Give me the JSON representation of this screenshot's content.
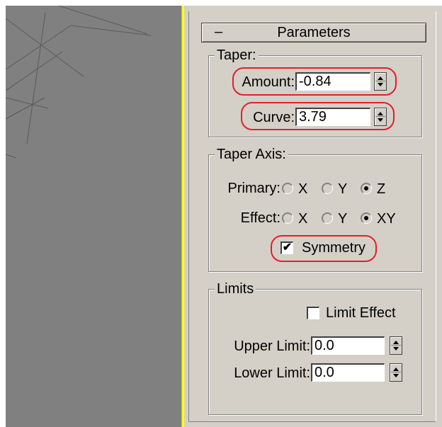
{
  "rollout": {
    "collapse_symbol": "–",
    "title": "Parameters"
  },
  "taper": {
    "group_label": "Taper:",
    "amount_label": "Amount:",
    "amount_value": "-0.84",
    "curve_label": "Curve:",
    "curve_value": "3.79"
  },
  "taper_axis": {
    "group_label": "Taper Axis:",
    "primary_label": "Primary:",
    "primary_options": [
      "X",
      "Y",
      "Z"
    ],
    "primary_selected": "Z",
    "effect_label": "Effect:",
    "effect_options": [
      "X",
      "Y",
      "XY"
    ],
    "effect_selected": "XY",
    "symmetry_label": "Symmetry",
    "symmetry_checked": true,
    "check_mark": "✔"
  },
  "limits": {
    "group_label": "Limits",
    "limit_effect_label": "Limit Effect",
    "limit_effect_checked": false,
    "upper_label": "Upper Limit:",
    "upper_value": "0.0",
    "lower_label": "Lower Limit:",
    "lower_value": "0.0"
  },
  "colors": {
    "viewport_bg": "#808080",
    "panel_bg": "#d4d0c8",
    "divider": "#ffff00",
    "highlight": "#e0202a"
  }
}
